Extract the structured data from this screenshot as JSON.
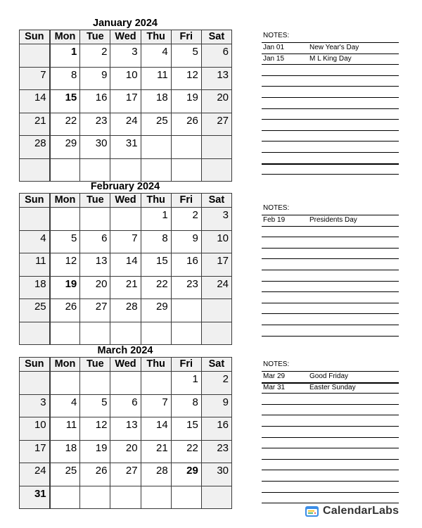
{
  "weekdays": [
    "Sun",
    "Mon",
    "Tue",
    "Wed",
    "Thu",
    "Fri",
    "Sat"
  ],
  "notes_label": "NOTES:",
  "brand": "CalendarLabs",
  "colors": {
    "weekend_bg": "#f0f0f0",
    "grid": "#3a3a3a",
    "logo_blue": "#3b8ee8"
  },
  "months": [
    {
      "title": "January 2024",
      "weeks": [
        [
          "",
          "1",
          "2",
          "3",
          "4",
          "5",
          "6"
        ],
        [
          "7",
          "8",
          "9",
          "10",
          "11",
          "12",
          "13"
        ],
        [
          "14",
          "15",
          "16",
          "17",
          "18",
          "19",
          "20"
        ],
        [
          "21",
          "22",
          "23",
          "24",
          "25",
          "26",
          "27"
        ],
        [
          "28",
          "29",
          "30",
          "31",
          "",
          "",
          ""
        ],
        [
          "",
          "",
          "",
          "",
          "",
          "",
          ""
        ]
      ],
      "holidays": [
        "1",
        "15"
      ],
      "notes": [
        {
          "date": "Jan 01",
          "text": "New Year's Day"
        },
        {
          "date": "Jan 15",
          "text": "M L King Day"
        }
      ]
    },
    {
      "title": "February 2024",
      "weeks": [
        [
          "",
          "",
          "",
          "",
          "1",
          "2",
          "3"
        ],
        [
          "4",
          "5",
          "6",
          "7",
          "8",
          "9",
          "10"
        ],
        [
          "11",
          "12",
          "13",
          "14",
          "15",
          "16",
          "17"
        ],
        [
          "18",
          "19",
          "20",
          "21",
          "22",
          "23",
          "24"
        ],
        [
          "25",
          "26",
          "27",
          "28",
          "29",
          "",
          ""
        ],
        [
          "",
          "",
          "",
          "",
          "",
          "",
          ""
        ]
      ],
      "holidays": [
        "19"
      ],
      "notes": [
        {
          "date": "Feb 19",
          "text": "Presidents Day"
        }
      ]
    },
    {
      "title": "March 2024",
      "weeks": [
        [
          "",
          "",
          "",
          "",
          "",
          "1",
          "2"
        ],
        [
          "3",
          "4",
          "5",
          "6",
          "7",
          "8",
          "9"
        ],
        [
          "10",
          "11",
          "12",
          "13",
          "14",
          "15",
          "16"
        ],
        [
          "17",
          "18",
          "19",
          "20",
          "21",
          "22",
          "23"
        ],
        [
          "24",
          "25",
          "26",
          "27",
          "28",
          "29",
          "30"
        ],
        [
          "31",
          "",
          "",
          "",
          "",
          "",
          ""
        ]
      ],
      "holidays": [
        "29",
        "31"
      ],
      "notes": [
        {
          "date": "Mar 29",
          "text": "Good Friday"
        },
        {
          "date": "Mar 31",
          "text": "Easter Sunday"
        }
      ]
    }
  ]
}
